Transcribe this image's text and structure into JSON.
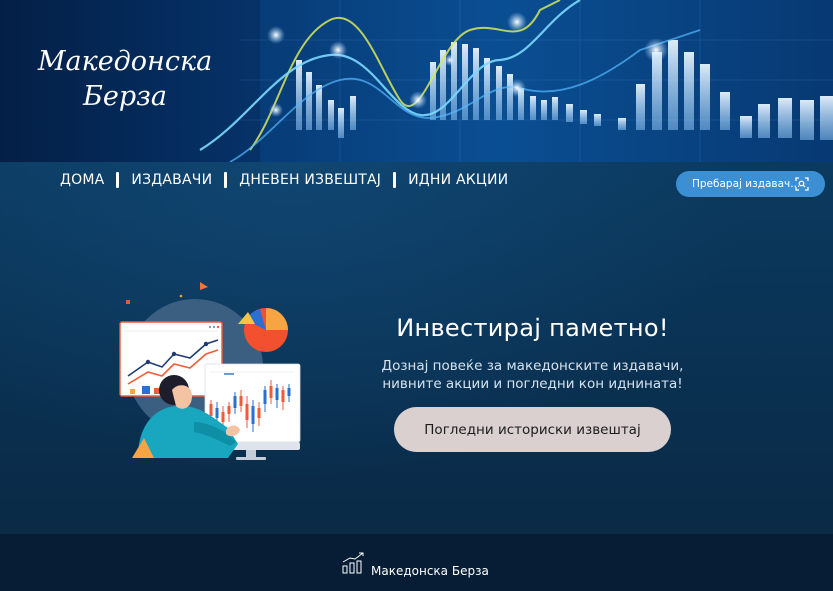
{
  "brand": {
    "line1": "Македонска",
    "line2": "Берза"
  },
  "nav": {
    "items": [
      {
        "label": "ДОМА"
      },
      {
        "label": "ИЗДАВАЧИ"
      },
      {
        "label": "ДНЕВЕН ИЗВЕШТАЈ"
      },
      {
        "label": "ИДНИ АКЦИИ"
      }
    ]
  },
  "search": {
    "placeholder": "Пребарај издавач..."
  },
  "hero": {
    "title": "Инвестирај паметно!",
    "subtitle_line1": "Дознај повеќе за македонските издавачи,",
    "subtitle_line2": "нивните акции и погледни кон иднината!",
    "cta_label": "Погледни историски извештај"
  },
  "footer": {
    "text": "Македонска Берза"
  },
  "colors": {
    "accent_search": "#3d8fd3",
    "cta_background": "#d9d0cf",
    "footer_background": "#071d35"
  }
}
